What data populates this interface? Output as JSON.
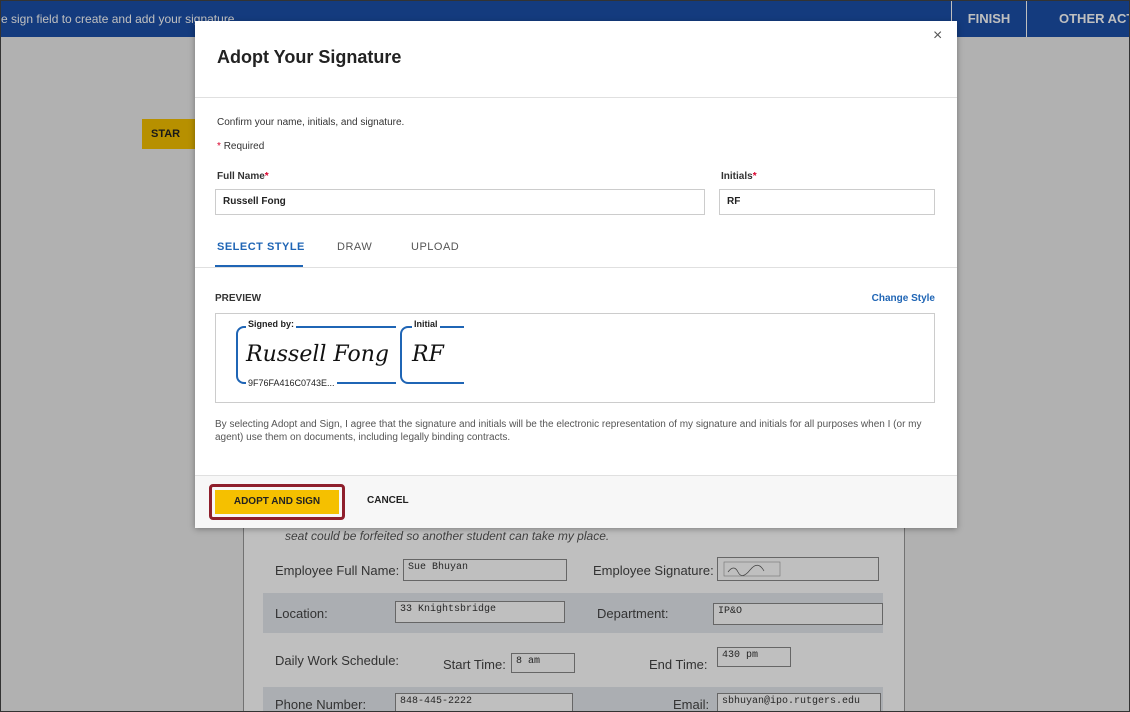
{
  "topbar": {
    "instruction": "e sign field to create and add your signature",
    "finish_label": "FINISH",
    "other_actions_label": "OTHER ACT"
  },
  "document": {
    "start_label": "STAR",
    "note": "seat could be forfeited so another student can take my place.",
    "employee_full_name_label": "Employee Full Name:",
    "employee_full_name_value": "Sue Bhuyan",
    "employee_signature_label": "Employee Signature:",
    "location_label": "Location:",
    "location_value": "33 Knightsbridge",
    "department_label": "Department:",
    "department_value": "IP&O",
    "daily_schedule_label": "Daily Work Schedule:",
    "start_time_label": "Start Time:",
    "start_time_value": "8 am",
    "end_time_label": "End Time:",
    "end_time_value": "430 pm",
    "phone_label": "Phone Number:",
    "phone_value": "848-445-2222",
    "email_label": "Email:",
    "email_value": "sbhuyan@ipo.rutgers.edu"
  },
  "modal": {
    "title": "Adopt Your Signature",
    "close_symbol": "×",
    "instructions": "Confirm your name, initials, and signature.",
    "required_star": "*",
    "required_text": "Required",
    "full_name_label": "Full Name",
    "full_name_value": "Russell Fong",
    "initials_label": "Initials",
    "initials_value": "RF",
    "tabs": [
      {
        "label": "SELECT STYLE",
        "active": true
      },
      {
        "label": "DRAW",
        "active": false
      },
      {
        "label": "UPLOAD",
        "active": false
      }
    ],
    "preview_heading": "PREVIEW",
    "change_style_label": "Change Style",
    "signed_by_label": "Signed by:",
    "signature_script": "Russell Fong",
    "signature_hash": "9F76FA416C0743E...",
    "initial_label": "Initial",
    "initial_script": "RF",
    "disclaimer": "By selecting Adopt and Sign, I agree that the signature and initials will be the electronic representation of my signature and initials for all purposes when I (or my agent) use them on documents, including legally binding contracts.",
    "adopt_button_label": "ADOPT AND SIGN",
    "cancel_button_label": "CANCEL"
  },
  "colors": {
    "topbar": "#1b4fa8",
    "accent_blue": "#1f65b5",
    "button_yellow": "#f5c000",
    "highlight_red": "#8f1f2c",
    "required_red": "#d9002b"
  }
}
